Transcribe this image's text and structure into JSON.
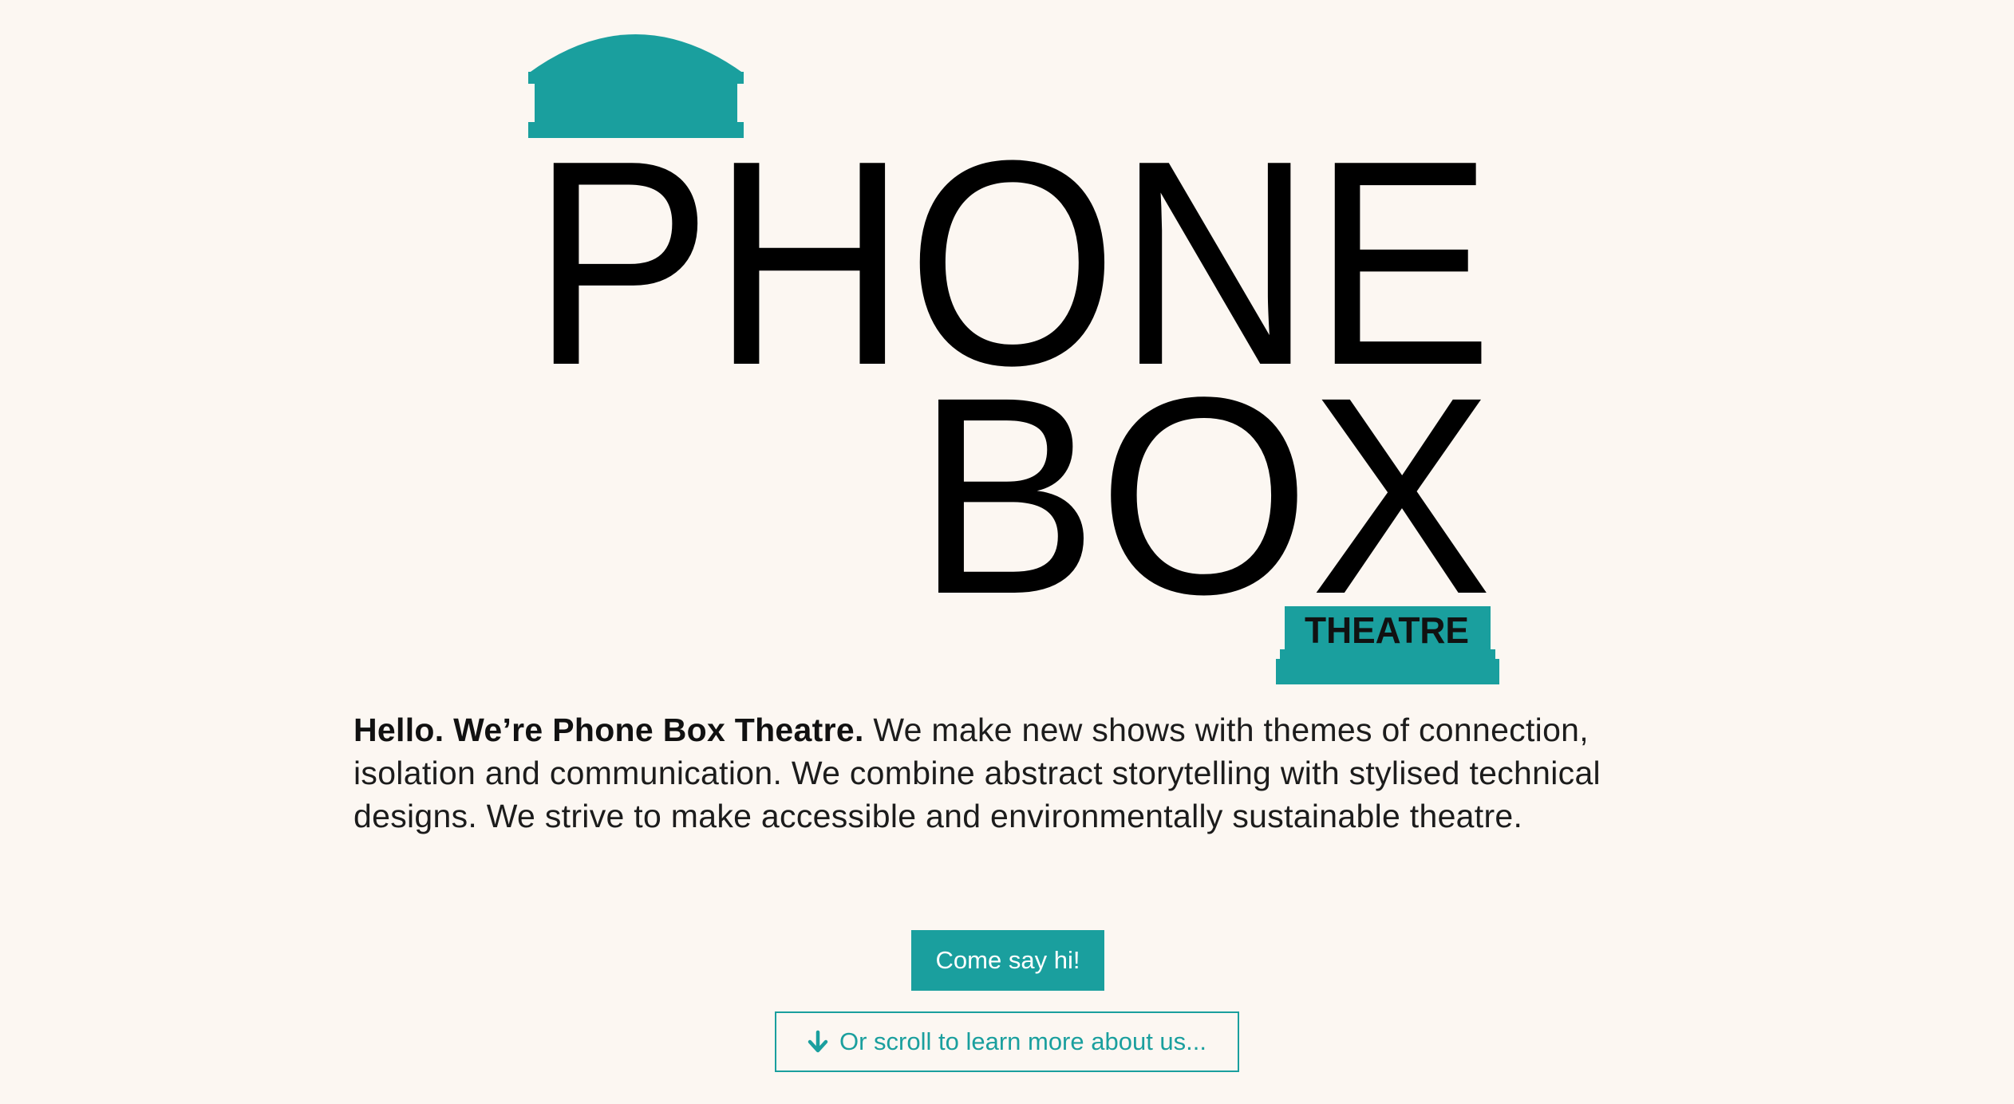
{
  "logo": {
    "word_line1": "PHONE",
    "word_line2": "BOX",
    "tagline": "THEATRE",
    "accent_color": "#1a9f9e",
    "text_color": "#000000"
  },
  "intro": {
    "lead": "Hello. We’re Phone Box Theatre.",
    "body": " We make new shows with themes of connection, isolation and communication. We combine abstract storytelling with stylised technical designs. We strive to make accessible and environmentally sustainable theatre."
  },
  "cta": {
    "label": "Come say hi!"
  },
  "scroll": {
    "label": "Or scroll to learn more about us...",
    "icon": "arrow-down-icon"
  },
  "colors": {
    "background": "#fcf7f2",
    "accent": "#1a9f9e"
  }
}
